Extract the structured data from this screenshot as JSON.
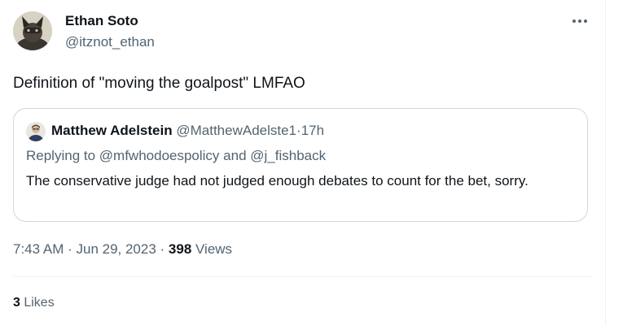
{
  "tweet": {
    "author": {
      "name": "Ethan Soto",
      "handle": "@itznot_ethan"
    },
    "more_icon": "more-horizontal-icon",
    "text": "Definition of \"moving the goalpost\" LMFAO",
    "quote": {
      "author_name": "Matthew Adelstein",
      "author_handle": "@MatthewAdelste1",
      "dot": "·",
      "time": "17h",
      "replying_prefix": "Replying to ",
      "mention_1": "@mfwhodoespolicy",
      "and": " and ",
      "mention_2": "@j_fishback",
      "text": "The conservative judge had not judged enough debates to count for the bet, sorry."
    },
    "meta": {
      "time": "7:43 AM",
      "sep1": " · ",
      "date": "Jun 29, 2023",
      "sep2": " · ",
      "views_count": "398",
      "views_label": " Views"
    },
    "likes": {
      "count": "3",
      "label": " Likes"
    }
  },
  "colors": {
    "text": "#0f1419",
    "secondary": "#536471",
    "border": "#cfd9de"
  }
}
